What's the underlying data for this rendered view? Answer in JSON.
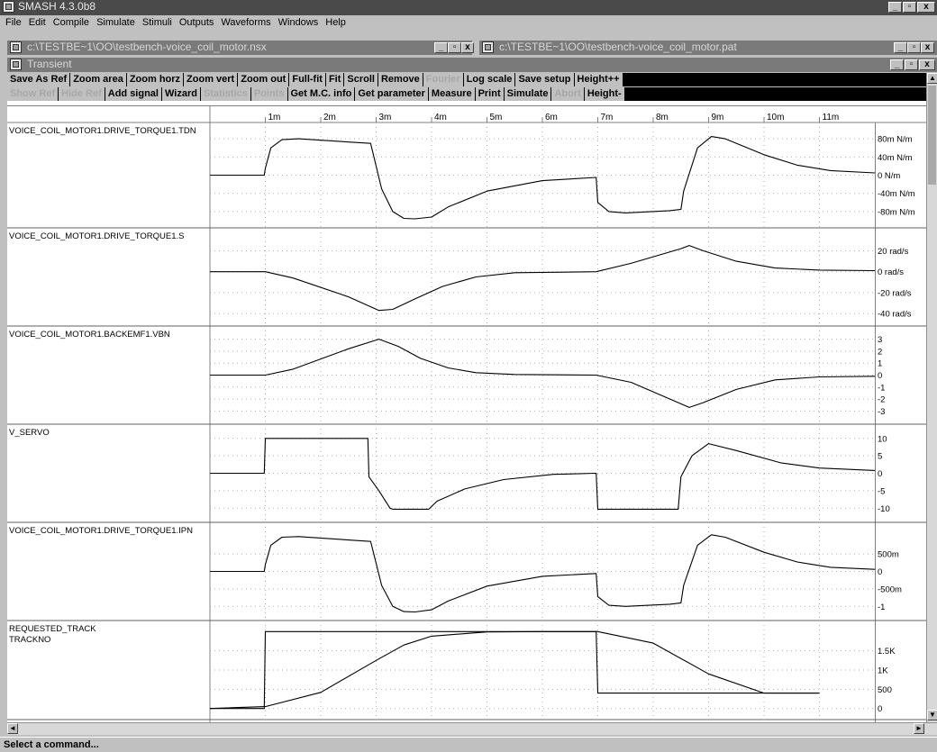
{
  "app": {
    "title": "SMASH 4.3.0b8"
  },
  "menu": [
    "File",
    "Edit",
    "Compile",
    "Simulate",
    "Stimuli",
    "Outputs",
    "Waveforms",
    "Windows",
    "Help"
  ],
  "doc_windows": [
    {
      "title": "c:\\TESTBE~1\\OO\\testbench-voice_coil_motor.nsx"
    },
    {
      "title": "c:\\TESTBE~1\\OO\\testbench-voice_coil_motor.pat"
    }
  ],
  "transient": {
    "title": "Transient"
  },
  "toolbar": {
    "row1": [
      {
        "label": "Save As Ref",
        "enabled": true
      },
      {
        "label": "Zoom area",
        "enabled": true
      },
      {
        "label": "Zoom horz",
        "enabled": true
      },
      {
        "label": "Zoom vert",
        "enabled": true
      },
      {
        "label": "Zoom out",
        "enabled": true
      },
      {
        "label": "Full-fit",
        "enabled": true
      },
      {
        "label": "Fit",
        "enabled": true
      },
      {
        "label": "Scroll",
        "enabled": true
      },
      {
        "label": "Remove",
        "enabled": true
      },
      {
        "label": "Fourier",
        "enabled": false
      },
      {
        "label": "Log scale",
        "enabled": true
      },
      {
        "label": "Save setup",
        "enabled": true
      },
      {
        "label": "Height++",
        "enabled": true
      }
    ],
    "row2": [
      {
        "label": "Show Ref",
        "enabled": false
      },
      {
        "label": "Hide Ref",
        "enabled": false
      },
      {
        "label": "Add signal",
        "enabled": true
      },
      {
        "label": "Wizard",
        "enabled": true
      },
      {
        "label": "Statistics",
        "enabled": false
      },
      {
        "label": "Points",
        "enabled": false
      },
      {
        "label": "Get M.C. info",
        "enabled": true
      },
      {
        "label": "Get parameter",
        "enabled": true
      },
      {
        "label": "Measure",
        "enabled": true
      },
      {
        "label": "Print",
        "enabled": true
      },
      {
        "label": "Simulate",
        "enabled": true
      },
      {
        "label": "Abort",
        "enabled": false
      },
      {
        "label": "Height-",
        "enabled": true
      }
    ]
  },
  "status": "Select a command...",
  "chart_data": {
    "type": "line",
    "x_ticks": [
      "1m",
      "2m",
      "3m",
      "4m",
      "5m",
      "6m",
      "7m",
      "8m",
      "9m",
      "10m",
      "11m"
    ],
    "xlim": [
      0,
      12
    ],
    "panels": [
      {
        "name": "VOICE_COIL_MOTOR1.DRIVE_TORQUE1.TDN",
        "ylim": [
          -100,
          100
        ],
        "y_ticks": [
          {
            "v": 80,
            "t": "80m N/m"
          },
          {
            "v": 40,
            "t": "40m N/m"
          },
          {
            "v": 0,
            "t": "0 N/m"
          },
          {
            "v": -40,
            "t": "-40m N/m"
          },
          {
            "v": -80,
            "t": "-80m N/m"
          }
        ],
        "points": [
          [
            0,
            0
          ],
          [
            0.98,
            0
          ],
          [
            1,
            15
          ],
          [
            1.1,
            60
          ],
          [
            1.3,
            78
          ],
          [
            1.6,
            80
          ],
          [
            2.9,
            70
          ],
          [
            3.1,
            -30
          ],
          [
            3.3,
            -80
          ],
          [
            3.5,
            -95
          ],
          [
            3.7,
            -96
          ],
          [
            4,
            -92
          ],
          [
            4.3,
            -70
          ],
          [
            5,
            -35
          ],
          [
            6,
            -12
          ],
          [
            6.97,
            -5
          ],
          [
            7,
            -60
          ],
          [
            7.2,
            -80
          ],
          [
            7.5,
            -83
          ],
          [
            8.3,
            -78
          ],
          [
            8.5,
            -75
          ],
          [
            8.55,
            -35
          ],
          [
            8.8,
            60
          ],
          [
            9.05,
            85
          ],
          [
            9.3,
            80
          ],
          [
            10,
            45
          ],
          [
            10.6,
            22
          ],
          [
            11.2,
            10
          ],
          [
            12,
            5
          ]
        ]
      },
      {
        "name": "VOICE_COIL_MOTOR1.DRIVE_TORQUE1.S",
        "ylim": [
          -45,
          35
        ],
        "y_ticks": [
          {
            "v": 20,
            "t": "20 rad/s"
          },
          {
            "v": 0,
            "t": "0 rad/s"
          },
          {
            "v": -20,
            "t": "-20 rad/s"
          },
          {
            "v": -40,
            "t": "-40 rad/s"
          }
        ],
        "points": [
          [
            0,
            0
          ],
          [
            1,
            0
          ],
          [
            1.5,
            -6
          ],
          [
            2.5,
            -24
          ],
          [
            3.05,
            -37
          ],
          [
            3.3,
            -36
          ],
          [
            3.7,
            -26
          ],
          [
            4.2,
            -14
          ],
          [
            4.8,
            -5
          ],
          [
            5.5,
            -1
          ],
          [
            6.97,
            0
          ],
          [
            7.6,
            8
          ],
          [
            8.5,
            22
          ],
          [
            8.65,
            25
          ],
          [
            8.9,
            20
          ],
          [
            9.5,
            10
          ],
          [
            10.2,
            3.5
          ],
          [
            11,
            1.5
          ],
          [
            12,
            1
          ]
        ]
      },
      {
        "name": "VOICE_COIL_MOTOR1.BACKEMF1.VBN",
        "ylim": [
          -3.5,
          3.5
        ],
        "y_ticks": [
          {
            "v": 3,
            "t": "3"
          },
          {
            "v": 2,
            "t": "2"
          },
          {
            "v": 1,
            "t": "1"
          },
          {
            "v": 0,
            "t": "0"
          },
          {
            "v": -1,
            "t": "-1"
          },
          {
            "v": -2,
            "t": "-2"
          },
          {
            "v": -3,
            "t": "-3"
          }
        ],
        "points": [
          [
            0,
            0
          ],
          [
            1,
            0
          ],
          [
            1.5,
            0.5
          ],
          [
            2.5,
            2.2
          ],
          [
            3.05,
            3.0
          ],
          [
            3.4,
            2.4
          ],
          [
            3.8,
            1.4
          ],
          [
            4.3,
            0.6
          ],
          [
            4.8,
            0.2
          ],
          [
            5.5,
            0.05
          ],
          [
            6.97,
            0
          ],
          [
            7.6,
            -0.6
          ],
          [
            8.5,
            -2.4
          ],
          [
            8.65,
            -2.7
          ],
          [
            8.9,
            -2.3
          ],
          [
            9.5,
            -1.2
          ],
          [
            10.2,
            -0.4
          ],
          [
            11,
            -0.15
          ],
          [
            12,
            -0.1
          ]
        ]
      },
      {
        "name": "V_SERVO",
        "ylim": [
          -12,
          12
        ],
        "y_ticks": [
          {
            "v": 10,
            "t": "10"
          },
          {
            "v": 5,
            "t": "5"
          },
          {
            "v": 0,
            "t": "0"
          },
          {
            "v": -5,
            "t": "-5"
          },
          {
            "v": -10,
            "t": "-10"
          }
        ],
        "points": [
          [
            0,
            0
          ],
          [
            0.98,
            0
          ],
          [
            1,
            10
          ],
          [
            2.85,
            10
          ],
          [
            2.87,
            -1
          ],
          [
            3.05,
            -5
          ],
          [
            3.25,
            -10
          ],
          [
            3.3,
            -10.3
          ],
          [
            3.95,
            -10.3
          ],
          [
            4.1,
            -8
          ],
          [
            4.6,
            -4.5
          ],
          [
            5.3,
            -1.8
          ],
          [
            6.2,
            -0.3
          ],
          [
            6.97,
            0
          ],
          [
            7,
            -10.3
          ],
          [
            8.45,
            -10.3
          ],
          [
            8.5,
            -1
          ],
          [
            8.7,
            5
          ],
          [
            9.0,
            8.5
          ],
          [
            9.5,
            6.5
          ],
          [
            10.3,
            3
          ],
          [
            11,
            1.5
          ],
          [
            12,
            0.8
          ]
        ]
      },
      {
        "name": "VOICE_COIL_MOTOR1.DRIVE_TORQUE1.IPN",
        "ylim": [
          -1.2,
          1.2
        ],
        "y_ticks": [
          {
            "v": 0.5,
            "t": "500m"
          },
          {
            "v": 0,
            "t": "0"
          },
          {
            "v": -0.5,
            "t": "-500m"
          },
          {
            "v": -1,
            "t": "-1"
          }
        ],
        "points": [
          [
            0,
            0
          ],
          [
            0.98,
            0
          ],
          [
            1,
            0.2
          ],
          [
            1.1,
            0.75
          ],
          [
            1.3,
            0.98
          ],
          [
            1.6,
            1.0
          ],
          [
            2.9,
            0.86
          ],
          [
            3.1,
            -0.4
          ],
          [
            3.3,
            -1.0
          ],
          [
            3.5,
            -1.15
          ],
          [
            3.7,
            -1.16
          ],
          [
            4,
            -1.1
          ],
          [
            4.3,
            -0.85
          ],
          [
            5,
            -0.42
          ],
          [
            6,
            -0.14
          ],
          [
            6.97,
            -0.06
          ],
          [
            7,
            -0.72
          ],
          [
            7.2,
            -0.97
          ],
          [
            7.5,
            -1.0
          ],
          [
            8.3,
            -0.94
          ],
          [
            8.5,
            -0.9
          ],
          [
            8.55,
            -0.4
          ],
          [
            8.8,
            0.75
          ],
          [
            9.05,
            1.05
          ],
          [
            9.3,
            0.98
          ],
          [
            10,
            0.55
          ],
          [
            10.6,
            0.27
          ],
          [
            11.2,
            0.12
          ],
          [
            12,
            0.06
          ]
        ]
      },
      {
        "name": "REQUESTED_TRACK",
        "sub": "TRACKNO",
        "ylim": [
          -100,
          2100
        ],
        "y_ticks": [
          {
            "v": 1500,
            "t": "1.5K"
          },
          {
            "v": 1000,
            "t": "1K"
          },
          {
            "v": 500,
            "t": "500"
          },
          {
            "v": 0,
            "t": "0"
          }
        ],
        "series": [
          {
            "points": [
              [
                0,
                0
              ],
              [
                0.98,
                0
              ],
              [
                1,
                2000
              ],
              [
                6.97,
                2000
              ],
              [
                7,
                400
              ],
              [
                11,
                400
              ]
            ]
          },
          {
            "points": [
              [
                0,
                0
              ],
              [
                1,
                50
              ],
              [
                2,
                420
              ],
              [
                3,
                1250
              ],
              [
                3.5,
                1650
              ],
              [
                4,
                1880
              ],
              [
                5,
                1990
              ],
              [
                6,
                2000
              ],
              [
                7,
                2000
              ],
              [
                8,
                1700
              ],
              [
                9,
                900
              ],
              [
                10,
                400
              ],
              [
                11,
                400
              ]
            ]
          }
        ]
      }
    ]
  }
}
